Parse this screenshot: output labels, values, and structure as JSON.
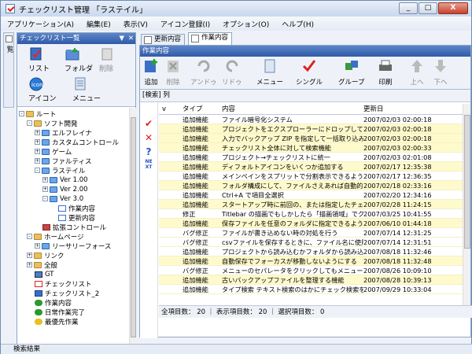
{
  "window": {
    "title": "チェックリスト管理 「ラステイル」",
    "min": "_",
    "max": "□",
    "close": "X"
  },
  "menu": [
    "アプリケーション(A)",
    "編集(E)",
    "表示(V)",
    "アイコン登録(I)",
    "オプション(O)",
    "ヘルプ(H)"
  ],
  "vertical_tab": "チェックリスト一覧",
  "left_panel": {
    "title": "チェックリスト一覧",
    "tools": {
      "list": "リスト",
      "folder": "フォルダ",
      "delete": "削除",
      "icon": "アイコン",
      "menu": "メニュー"
    },
    "tree": [
      {
        "label": "ルート"
      },
      {
        "label": "ソフト開発"
      },
      {
        "label": "エルフレイナ"
      },
      {
        "label": "カスタムコントロール"
      },
      {
        "label": "ゲーム"
      },
      {
        "label": "ファルティス"
      },
      {
        "label": "ラステイル"
      },
      {
        "label": "Ver 1.00"
      },
      {
        "label": "Ver 2.00"
      },
      {
        "label": "Ver 3.0"
      },
      {
        "label": "作業内容"
      },
      {
        "label": "更新内容"
      },
      {
        "label": "拡張コントロール"
      },
      {
        "label": "ホームページ"
      },
      {
        "label": "リーサリーフォース"
      },
      {
        "label": "リンク"
      },
      {
        "label": "全般"
      },
      {
        "label": "GT"
      },
      {
        "label": "チェックリスト"
      },
      {
        "label": "チェックリスト_2"
      },
      {
        "label": "作業内容"
      },
      {
        "label": "日常作業完了"
      },
      {
        "label": "最優先作業"
      }
    ]
  },
  "search_results": "検索結果",
  "tabs": [
    {
      "label": "更新内容"
    },
    {
      "label": "作業内容"
    }
  ],
  "right_panel": {
    "title": "作業内容",
    "tools": {
      "add": "追加",
      "delete": "削除",
      "undo": "アンドゥ",
      "redo": "リドゥ",
      "menu": "メニュー",
      "single": "シングル",
      "group": "グループ",
      "print": "印刷",
      "up": "上へ",
      "down": "下へ"
    },
    "filter": "[検索] 列",
    "columns": [
      "v",
      "タイプ",
      "内容",
      "更新日"
    ],
    "rows": [
      {
        "type": "追加機能",
        "content": "ファイル暗号化システム",
        "date": "2007/02/03 02:00:18",
        "hl": false
      },
      {
        "type": "追加機能",
        "content": "プロジェクトをエクスプローラーにドロップして xml ファイ…",
        "date": "2007/02/03 02:00:18",
        "hl": true
      },
      {
        "type": "追加機能",
        "content": "入力でバックアップ ZIP を指定して一括取り込み",
        "date": "2007/02/03 02:00:18",
        "hl": true
      },
      {
        "type": "追加機能",
        "content": "チェックリスト全体に対して検索機能",
        "date": "2007/02/03 02:00:33",
        "hl": true
      },
      {
        "type": "追加機能",
        "content": "プロジェクト→チェックリストに統一",
        "date": "2007/02/03 02:01:08",
        "hl": false
      },
      {
        "type": "追加機能",
        "content": "ディフォルトアイコンをいくつか追加する",
        "date": "2007/02/17 12:35:38",
        "hl": true
      },
      {
        "type": "追加機能",
        "content": "メインペインをスプリットで分割表示できるようにする",
        "date": "2007/02/17 12:36:35",
        "hl": false
      },
      {
        "type": "追加機能",
        "content": "フォルダ構成にして、ファイルさえあれば自動的にツリー…",
        "date": "2007/02/18 02:33:16",
        "hl": true
      },
      {
        "type": "追加機能",
        "content": "Ctrl+A で項目全選択",
        "date": "2007/02/20 12:34:16",
        "hl": false
      },
      {
        "type": "追加機能",
        "content": "スタートアップ時に前回の、または指定したチェックリスト…",
        "date": "2007/02/28 11:24:15",
        "hl": true
      },
      {
        "type": "修正",
        "content": "Titlebar の描画でもしかしたら「描画領域」でクライアン…",
        "date": "2007/03/25 10:41:55",
        "hl": false
      },
      {
        "type": "追加機能",
        "content": "保存ファイルを任意のフォルダに指定できるようにする",
        "date": "2007/06/10 01:44:18",
        "hl": true
      },
      {
        "type": "バグ修正",
        "content": "ファイルが書き込めない時の対処を行う",
        "date": "2007/07/14 12:31:25",
        "hl": false
      },
      {
        "type": "バグ修正",
        "content": "csvファイルを保存するときに、ファイル名に使用できな…",
        "date": "2007/07/14 12:31:51",
        "hl": false
      },
      {
        "type": "追加機能",
        "content": "プロジェクトから読み込むかフォルダから読み込むか選択で…",
        "date": "2007/08/18 11:32:46",
        "hl": false
      },
      {
        "type": "追加機能",
        "content": "自動保存でフォーカスが移動しないようにする",
        "date": "2007/08/18 11:32:48",
        "hl": true
      },
      {
        "type": "バグ修正",
        "content": "メニューのセパレータをクリックしてもメニューが開かない…",
        "date": "2007/08/26 10:09:10",
        "hl": false
      },
      {
        "type": "追加機能",
        "content": "古いバックアップファイルを整理する機能",
        "date": "2007/08/28 10:39:13",
        "hl": true
      },
      {
        "type": "追加機能",
        "content": "タイプ検索 テキスト検索のはかにチェック検索を追加",
        "date": "2007/09/29 10:33:04",
        "hl": false
      }
    ],
    "status": "全項目数： 20 ｜ 表示項目数： 20 ｜ 選択項目数： 0",
    "gutter_icons": {
      "next": "NE XT"
    }
  }
}
